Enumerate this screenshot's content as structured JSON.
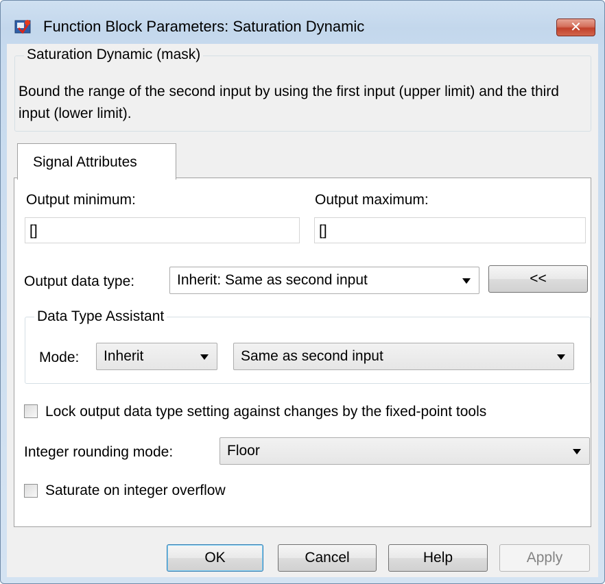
{
  "window": {
    "title": "Function Block Parameters: Saturation Dynamic",
    "close_label": "✕"
  },
  "mask_group": {
    "label": "Saturation Dynamic (mask)",
    "description": "Bound the range of the second input by using the first input (upper limit) and the third input (lower limit)."
  },
  "tabs": [
    {
      "label": "Signal Attributes"
    }
  ],
  "signal_attributes": {
    "output_min_label": "Output minimum:",
    "output_min_value": "[]",
    "output_max_label": "Output maximum:",
    "output_max_value": "[]",
    "output_data_type_label": "Output data type:",
    "output_data_type_value": "Inherit: Same as second input",
    "assistant_toggle_label": "<<",
    "assistant": {
      "label": "Data Type Assistant",
      "mode_label": "Mode:",
      "mode_value": "Inherit",
      "inherit_rule_value": "Same as second input"
    },
    "lock_checkbox_label": "Lock output data type setting against changes by the fixed-point tools",
    "lock_checked": false,
    "rounding_label": "Integer rounding mode:",
    "rounding_value": "Floor",
    "saturate_checkbox_label": "Saturate on integer overflow",
    "saturate_checked": false
  },
  "buttons": {
    "ok": "OK",
    "cancel": "Cancel",
    "help": "Help",
    "apply": "Apply"
  }
}
